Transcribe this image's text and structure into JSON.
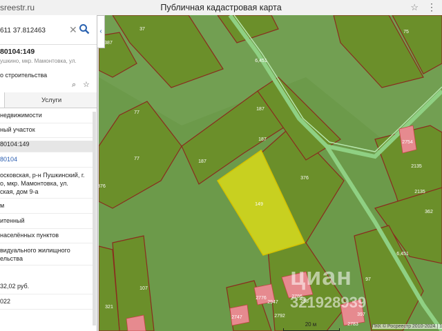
{
  "window": {
    "url": "sreestr.ru",
    "title": "Публичная кадастровая карта",
    "star_glyph": "☆",
    "menu_glyph": "⋮"
  },
  "search": {
    "value": "611 37.812463",
    "clear_glyph": "✕"
  },
  "panel": {
    "cadastral_number": "80104:149",
    "address_short": "ушкино, мкр. Мамонтовка, ул.",
    "purpose_short": "о строительства",
    "tab_services": "Услуги",
    "collapse_glyph": "‹",
    "rows": [
      {
        "text": "недвижимости"
      },
      {
        "text": "ный участок"
      },
      {
        "text": "80104:149"
      },
      {
        "text": "80104"
      },
      {
        "text": "осковская, р-н Пушкинский, г."
      },
      {
        "text": "о, мкр. Мамонтовка, ул."
      },
      {
        "text": "ская, дом 9-а"
      },
      {
        "text": "м"
      },
      {
        "text": "итенный"
      },
      {
        "text": "населённых пунктов"
      },
      {
        "text": "видуального жилищного"
      },
      {
        "text": "ельства"
      },
      {
        "text": "32,02 руб."
      },
      {
        "text": "022"
      }
    ]
  },
  "map": {
    "parcel_labels": [
      "37",
      "387",
      "75",
      "77",
      "187",
      "187",
      "187",
      "77",
      "376",
      "149",
      "376",
      "362",
      "2135",
      "107",
      "321",
      "2947",
      "97",
      "258",
      "2783",
      "397",
      "2135",
      "6,451",
      "6,451",
      "2776",
      "2754",
      "2786",
      "2747",
      "2792"
    ],
    "scale_label": "20 м",
    "copyright": "ПКК © Росреестр 2010-2024 | 1",
    "watermark_brand": "циан",
    "watermark_id": "321928939",
    "colors": {
      "bg": "#6f9e4f",
      "parcel": "#6b8f2a",
      "parcel_border": "#8a2b1e",
      "selected": "#c8d020",
      "road": "#86c878",
      "building": "#e68a8f"
    }
  }
}
